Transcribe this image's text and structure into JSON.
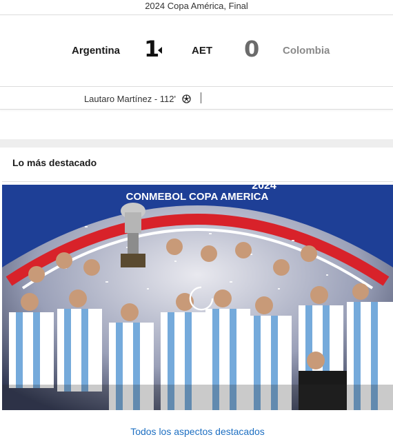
{
  "header": {
    "title": "2024 Copa América, Final"
  },
  "match": {
    "home_team": "Argentina",
    "home_score": "1",
    "status": "AET",
    "away_score": "0",
    "away_team": "Colombia"
  },
  "goals": [
    {
      "text": "Lautaro Martínez - 112'",
      "icon": "soccer-ball-icon"
    }
  ],
  "highlights": {
    "section_title": "Lo más destacado",
    "banner_text": "CONMEBOL COPA AMERICA",
    "banner_year": "2024",
    "link_label": "Todos los aspectos destacados"
  },
  "colors": {
    "link": "#1d6fc2",
    "banner_red": "#d8222a",
    "banner_blue": "#1e3f96",
    "shirt_sky": "#75aadb"
  }
}
